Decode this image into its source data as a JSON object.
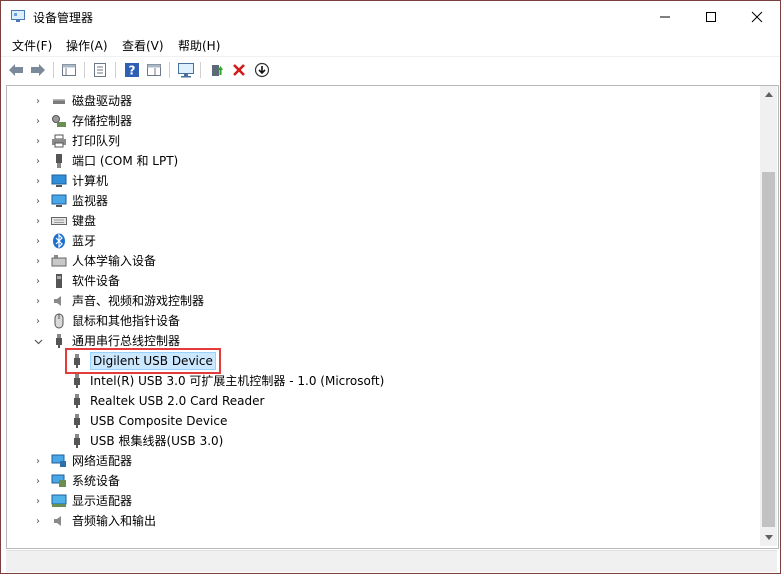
{
  "window": {
    "title": "设备管理器"
  },
  "menu": [
    "文件(F)",
    "操作(A)",
    "查看(V)",
    "帮助(H)"
  ],
  "toolbar": [
    {
      "name": "back-arrow-icon"
    },
    {
      "name": "forward-arrow-icon"
    },
    {
      "name": "properties-sheet-icon"
    },
    {
      "name": "list-view-icon"
    },
    {
      "name": "help-icon"
    },
    {
      "name": "details-view-icon"
    },
    {
      "name": "monitor-scan-icon"
    },
    {
      "name": "update-driver-icon"
    },
    {
      "name": "uninstall-x-icon"
    },
    {
      "name": "download-circle-icon"
    }
  ],
  "tree": {
    "categories_top": [
      {
        "label": "磁盘驱动器",
        "icon": "disk-drive-icon"
      },
      {
        "label": "存储控制器",
        "icon": "storage-controller-icon"
      },
      {
        "label": "打印队列",
        "icon": "printer-icon"
      },
      {
        "label": "端口 (COM 和 LPT)",
        "icon": "port-icon"
      },
      {
        "label": "计算机",
        "icon": "computer-icon"
      },
      {
        "label": "监视器",
        "icon": "monitor-icon"
      },
      {
        "label": "键盘",
        "icon": "keyboard-icon"
      },
      {
        "label": "蓝牙",
        "icon": "bluetooth-icon"
      },
      {
        "label": "人体学输入设备",
        "icon": "hid-icon"
      },
      {
        "label": "软件设备",
        "icon": "software-device-icon"
      },
      {
        "label": "声音、视频和游戏控制器",
        "icon": "speaker-icon"
      },
      {
        "label": "鼠标和其他指针设备",
        "icon": "mouse-icon"
      }
    ],
    "expanded": {
      "label": "通用串行总线控制器",
      "icon": "usb-icon",
      "children": [
        {
          "label": "Digilent USB Device",
          "selected": true
        },
        {
          "label": "Intel(R) USB 3.0 可扩展主机控制器 - 1.0 (Microsoft)"
        },
        {
          "label": "Realtek USB 2.0 Card Reader"
        },
        {
          "label": "USB Composite Device"
        },
        {
          "label": "USB 根集线器(USB 3.0)"
        }
      ]
    },
    "categories_bottom": [
      {
        "label": "网络适配器",
        "icon": "network-adapter-icon"
      },
      {
        "label": "系统设备",
        "icon": "system-device-icon"
      },
      {
        "label": "显示适配器",
        "icon": "display-adapter-icon"
      },
      {
        "label": "音频输入和输出",
        "icon": "audio-io-icon"
      }
    ]
  }
}
